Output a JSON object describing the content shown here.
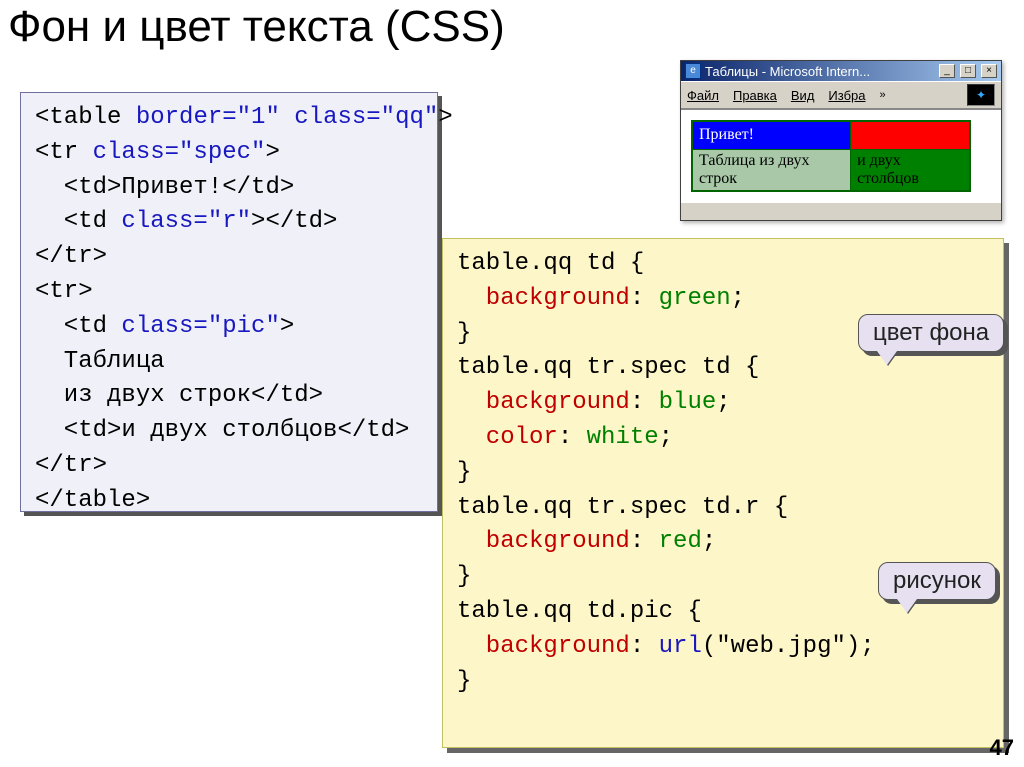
{
  "title": "Фон и цвет текста (CSS)",
  "page_number": "47",
  "callouts": {
    "bg": "цвет фона",
    "pic": "рисунок"
  },
  "ie": {
    "title": "Таблицы - Microsoft Intern...",
    "menu": [
      "Файл",
      "Правка",
      "Вид",
      "Избра"
    ],
    "cells": {
      "r1c1": "Привет!",
      "r1c2": "",
      "r2c1": "Таблица из двух строк",
      "r2c2": "и двух столбцов"
    }
  },
  "html_code": {
    "l1a": "<table ",
    "l1b": "border=\"1\"",
    "l1c": " class=\"qq\"",
    "l1d": ">",
    "l2a": "<tr ",
    "l2b": "class=\"spec\"",
    "l2c": ">",
    "l3": "  <td>Привет!</td>",
    "l4a": "  <td ",
    "l4b": "class=\"r\"",
    "l4c": "></td>",
    "l5": "</tr>",
    "l6": "<tr>",
    "l7a": "  <td ",
    "l7b": "class=\"pic\"",
    "l7c": ">",
    "l8": "  Таблица",
    "l9": "  из двух строк</td>",
    "l10": "  <td>и двух столбцов</td>",
    "l11": "</tr>",
    "l12": "</table>"
  },
  "css_code": {
    "s1": "table.qq td {",
    "s2a": "  background",
    "s2b": ": ",
    "s2c": "green",
    "s2d": ";",
    "s3": "}",
    "s4": "table.qq tr.spec td {",
    "s5a": "  background",
    "s5b": ": ",
    "s5c": "blue",
    "s5d": ";",
    "s6a": "  color",
    "s6b": ": ",
    "s6c": "white",
    "s6d": ";",
    "s7": "}",
    "s8": "table.qq tr.spec td.r {",
    "s9a": "  background",
    "s9b": ": ",
    "s9c": "red",
    "s9d": ";",
    "s10": "}",
    "s11": "table.qq td.pic {",
    "s12a": "  background",
    "s12b": ": ",
    "s12c": "url",
    "s12d": "(\"web.jpg\");",
    "s13": "}"
  }
}
